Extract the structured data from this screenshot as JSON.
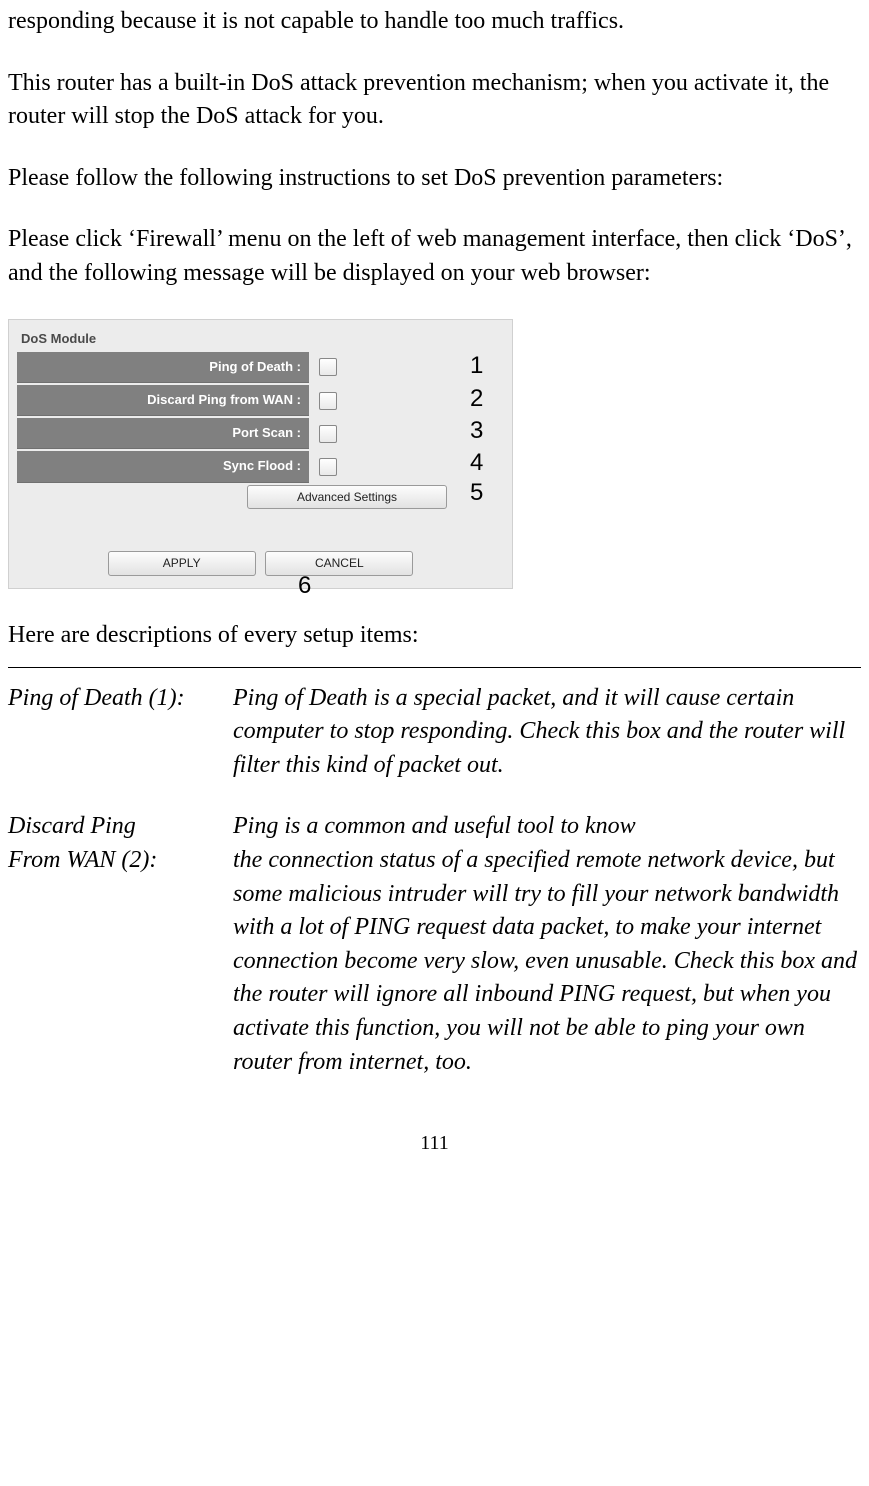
{
  "doc": {
    "para0": "responding because it is not capable to handle too much traffics.",
    "para1": "This router has a built-in DoS attack prevention mechanism; when you activate it, the router will stop the DoS attack for you.",
    "para2": "Please follow the following instructions to set DoS prevention parameters:",
    "para3": "Please click ‘Firewall’ menu on the left of web management interface, then click ‘DoS’, and the following message will be displayed on your web browser:",
    "descIntro": "Here are descriptions of every setup items:",
    "pageNum": "111"
  },
  "screenshot": {
    "moduleTitle": "DoS Module",
    "rows": [
      {
        "label": "Ping of Death :"
      },
      {
        "label": "Discard Ping from WAN :"
      },
      {
        "label": "Port Scan :"
      },
      {
        "label": "Sync Flood :"
      }
    ],
    "advanced": "Advanced Settings",
    "apply": "APPLY",
    "cancel": "CANCEL"
  },
  "callouts": {
    "c1": "1",
    "c2": "2",
    "c3": "3",
    "c4": "4",
    "c5": "5",
    "c6": "6"
  },
  "descriptions": {
    "item1": {
      "term": "Ping of Death (1):",
      "text": "Ping of Death is a special packet, and it will cause certain computer to stop responding. Check this box and the router will filter this kind of packet out."
    },
    "item2": {
      "termA": "Discard Ping",
      "termB": "From WAN (2):",
      "textA": "Ping is a common and useful tool to know",
      "textB": "the connection status of a specified remote network device, but some malicious intruder will try to fill your network bandwidth with a lot of PING request data packet, to make your internet connection become very slow, even unusable. Check this box and the router will ignore all inbound PING request, but when you activate this function, you will not be able to ping your own router from internet, too."
    }
  }
}
